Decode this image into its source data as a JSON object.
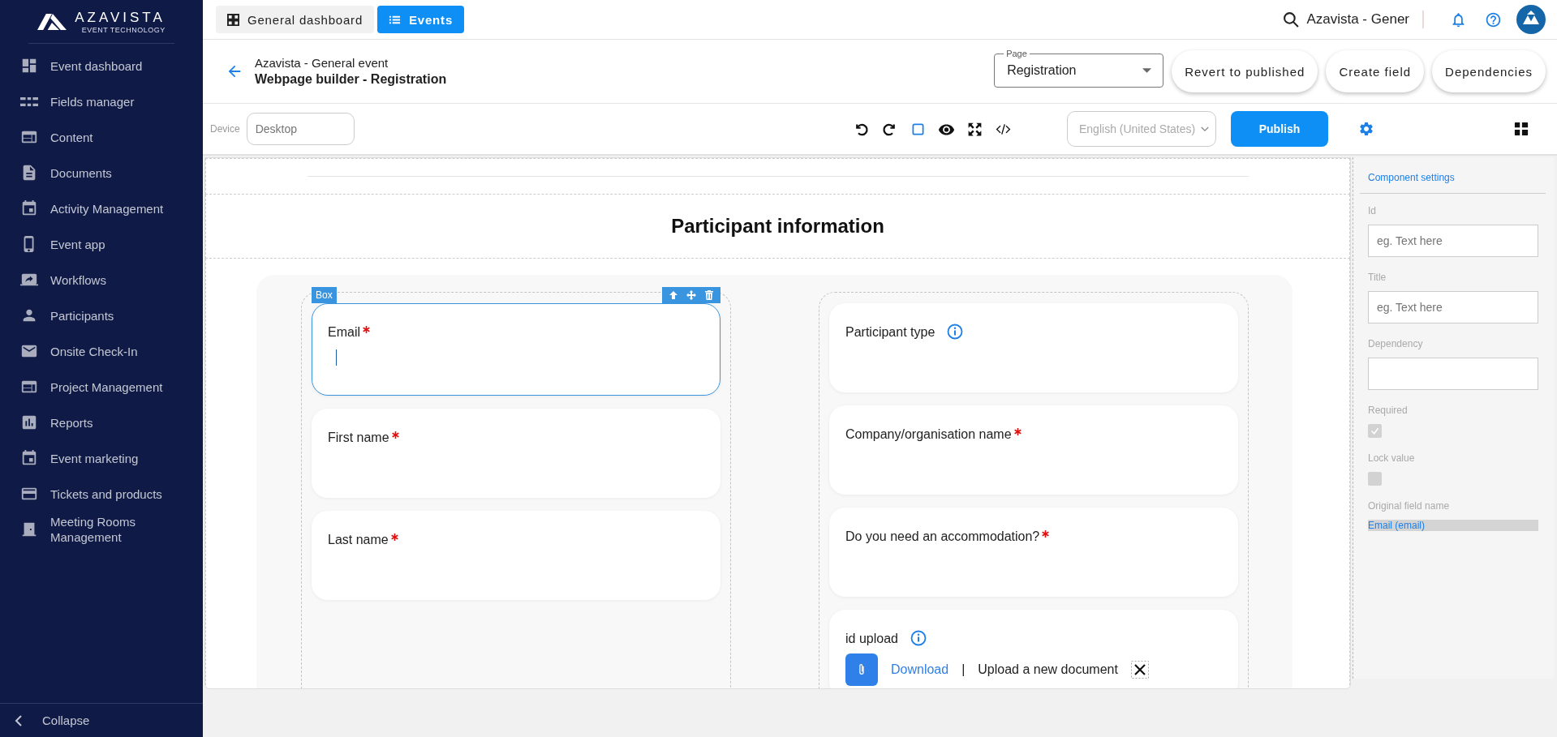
{
  "sidebar": {
    "logo": {
      "name": "AZAVISTA",
      "tagline": "EVENT TECHNOLOGY"
    },
    "items": [
      {
        "label": "Event dashboard"
      },
      {
        "label": "Fields manager"
      },
      {
        "label": "Content"
      },
      {
        "label": "Documents"
      },
      {
        "label": "Activity Management"
      },
      {
        "label": "Event app"
      },
      {
        "label": "Workflows"
      },
      {
        "label": "Participants"
      },
      {
        "label": "Onsite Check-In"
      },
      {
        "label": "Project Management"
      },
      {
        "label": "Reports"
      },
      {
        "label": "Event marketing"
      },
      {
        "label": "Tickets and products"
      },
      {
        "label": "Meeting Rooms Management"
      }
    ],
    "collapse": "Collapse"
  },
  "top_bar": {
    "tabs": [
      {
        "label": "General dashboard",
        "selected": false
      },
      {
        "label": "Events",
        "selected": true
      }
    ],
    "search_text": "Azavista - Gener"
  },
  "header": {
    "event_name": "Azavista - General event",
    "page_title": "Webpage builder - Registration",
    "page_select": {
      "label": "Page",
      "value": "Registration"
    },
    "buttons": [
      "Revert to published",
      "Create field",
      "Dependencies"
    ]
  },
  "toolbar": {
    "device_label": "Device",
    "device_placeholder": "Desktop",
    "language": "English (United States)",
    "publish": "Publish"
  },
  "canvas": {
    "section_title": "Participant information",
    "box_label": "Box",
    "columns": [
      [
        {
          "kind": "text",
          "label": "Email",
          "required": true,
          "info": false,
          "selected": true
        },
        {
          "kind": "text",
          "label": "First name",
          "required": true,
          "info": false,
          "selected": false
        },
        {
          "kind": "text",
          "label": "Last name",
          "required": true,
          "info": false,
          "selected": false
        }
      ],
      [
        {
          "kind": "text",
          "label": "Participant type",
          "required": false,
          "info": true,
          "selected": false
        },
        {
          "kind": "text",
          "label": "Company/organisation name",
          "required": true,
          "info": false,
          "selected": false
        },
        {
          "kind": "text",
          "label": "Do you need an accommodation?",
          "required": true,
          "info": false,
          "selected": false
        },
        {
          "kind": "upload",
          "label": "id upload",
          "required": false,
          "info": true,
          "selected": false,
          "download": "Download",
          "separator": "|",
          "upload": "Upload a new document"
        }
      ]
    ]
  },
  "settings": {
    "title": "Component settings",
    "fields": [
      {
        "label": "Id",
        "placeholder": "eg. Text here"
      },
      {
        "label": "Title",
        "placeholder": "eg. Text here"
      },
      {
        "label": "Dependency"
      }
    ],
    "checkboxes": [
      {
        "label": "Required",
        "checked": true,
        "disabled": true
      },
      {
        "label": "Lock value",
        "checked": false,
        "disabled": true
      }
    ],
    "original_field": {
      "label": "Original field name",
      "value": "Email (email)"
    }
  }
}
